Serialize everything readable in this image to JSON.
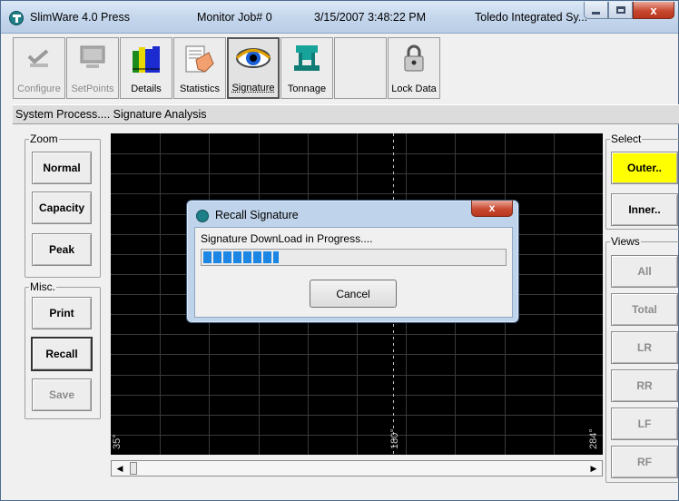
{
  "window": {
    "app_title": "SlimWare 4.0  Press",
    "job": "Monitor Job# 0",
    "datetime": "3/15/2007  3:48:22 PM",
    "company": "Toledo Integrated Sy...",
    "close_glyph": "x"
  },
  "toolbar": {
    "configure": "Configure",
    "setpoints": "SetPoints",
    "details": "Details",
    "statistics": "Statistics",
    "signature": "Signature",
    "tonnage": "Tonnage",
    "lock_data": "Lock Data"
  },
  "subtitle": "System Process.... Signature Analysis",
  "zoom": {
    "title": "Zoom",
    "normal": "Normal",
    "capacity": "Capacity",
    "peak": "Peak"
  },
  "misc": {
    "title": "Misc.",
    "print": "Print",
    "recall": "Recall",
    "save": "Save"
  },
  "select": {
    "title": "Select",
    "outer": "Outer..",
    "inner": "Inner.."
  },
  "views": {
    "title": "Views",
    "all": "All",
    "total": "Total",
    "lr": "LR",
    "rr": "RR",
    "lf": "LF",
    "rf": "RF"
  },
  "chart": {
    "label_left": "35°",
    "label_mid": "180°",
    "label_right": "284°",
    "grid_color": "#3a3a3a",
    "label_color": "#c8c8c8"
  },
  "dialog": {
    "title": "Recall Signature",
    "message": "Signature DownLoad in Progress....",
    "cancel": "Cancel",
    "close_glyph": "x",
    "progress_fraction": 0.25
  }
}
